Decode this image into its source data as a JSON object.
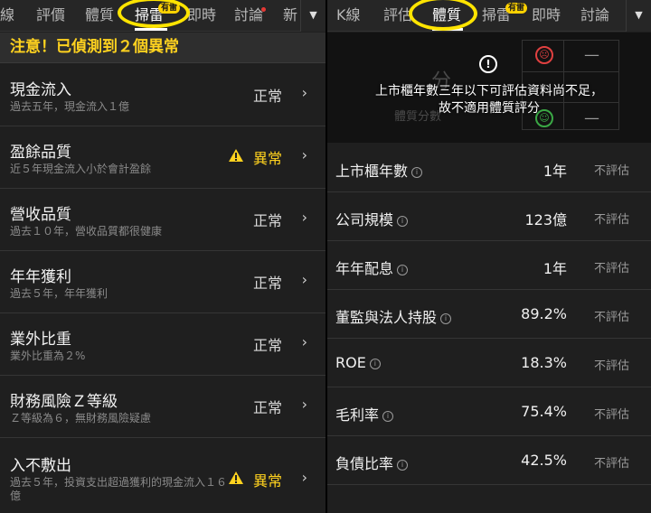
{
  "left": {
    "tabs": [
      {
        "label": "線"
      },
      {
        "label": "評價"
      },
      {
        "label": "體質"
      },
      {
        "label": "掃雷",
        "badge": "有雷",
        "active": true
      },
      {
        "label": "即時"
      },
      {
        "label": "討論"
      },
      {
        "label": "新"
      }
    ],
    "alert": "注意！已偵測到２個異常",
    "items": [
      {
        "title": "現金流入",
        "subtitle": "過去五年，現金流入１億",
        "status": "正常",
        "warning": false
      },
      {
        "title": "盈餘品質",
        "subtitle": "近５年現金流入小於會計盈餘",
        "status": "異常",
        "warning": true
      },
      {
        "title": "營收品質",
        "subtitle": "過去１０年，營收品質都很健康",
        "status": "正常",
        "warning": false
      },
      {
        "title": "年年獲利",
        "subtitle": "過去５年，年年獲利",
        "status": "正常",
        "warning": false
      },
      {
        "title": "業外比重",
        "subtitle": "業外比重為２%",
        "status": "正常",
        "warning": false
      },
      {
        "title": "財務風險Ｚ等級",
        "subtitle": "Ｚ等級為６，無財務風險疑慮",
        "status": "正常",
        "warning": false
      },
      {
        "title": "入不敷出",
        "subtitle": "過去５年，投資支出超過獲利的現金流入１６億",
        "status": "異常",
        "warning": true
      }
    ]
  },
  "right": {
    "tabs": [
      {
        "label": "K線"
      },
      {
        "label": "評估"
      },
      {
        "label": "體質",
        "active": true
      },
      {
        "label": "掃雷",
        "badge": "有雷"
      },
      {
        "label": "即時"
      },
      {
        "label": "討論"
      }
    ],
    "ghost_score": "分",
    "ghost_label": "體質分數",
    "message_line1": "上市櫃年數三年以下可評估資料尚不足，",
    "message_line2": "故不適用體質評分",
    "metrics": [
      {
        "label": "上市櫃年數",
        "value": "1年",
        "eval": "不評估"
      },
      {
        "label": "公司規模",
        "value": "123億",
        "eval": "不評估"
      },
      {
        "label": "年年配息",
        "value": "1年",
        "eval": "不評估"
      },
      {
        "label": "董監與法人持股",
        "value": "89.2%",
        "eval": "不評估"
      },
      {
        "label": "ROE",
        "value": "18.3%",
        "eval": "不評估"
      },
      {
        "label": "毛利率",
        "value": "75.4%",
        "eval": "不評估"
      },
      {
        "label": "負債比率",
        "value": "42.5%",
        "eval": "不評估"
      }
    ]
  },
  "colors": {
    "warning": "#ffd21f",
    "highlight_circle": "#ffe400",
    "badge": "#ffd200",
    "happy_face": "#3aa845",
    "sad_face": "#e04040"
  }
}
